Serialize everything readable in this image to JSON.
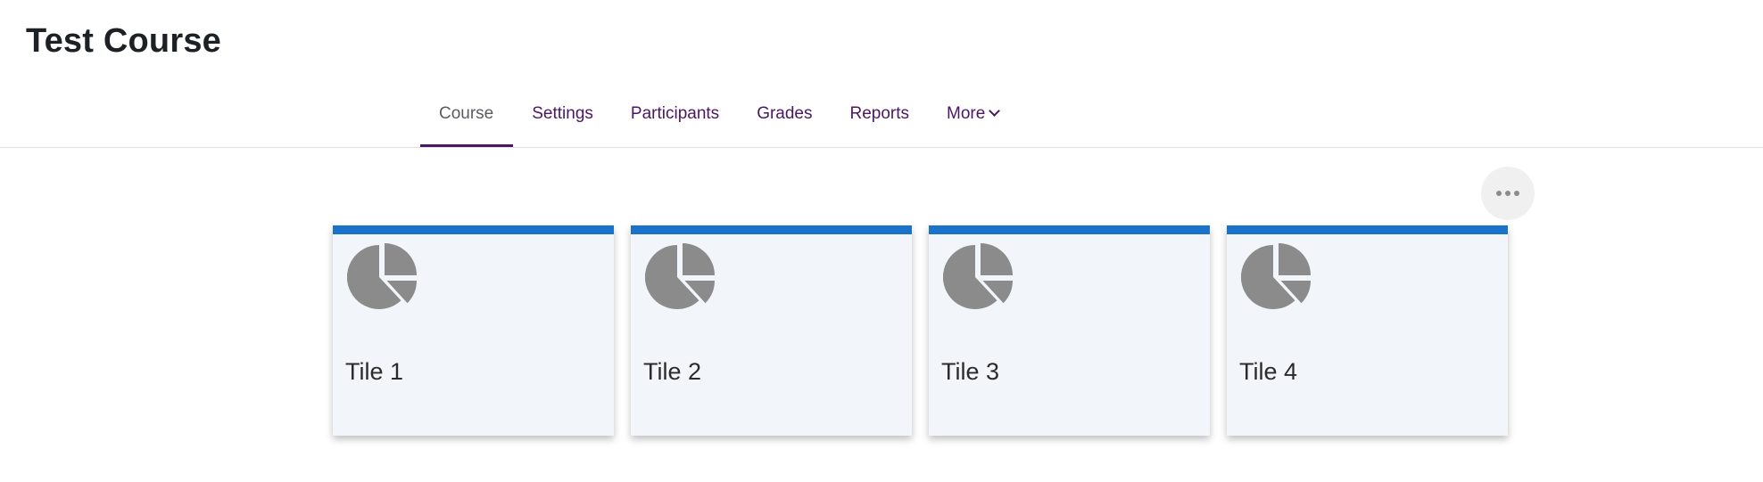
{
  "course": {
    "title": "Test Course"
  },
  "nav": {
    "tabs": [
      {
        "label": "Course",
        "active": true
      },
      {
        "label": "Settings",
        "active": false
      },
      {
        "label": "Participants",
        "active": false
      },
      {
        "label": "Grades",
        "active": false
      },
      {
        "label": "Reports",
        "active": false
      },
      {
        "label": "More",
        "active": false,
        "has_dropdown": true
      }
    ]
  },
  "actions": {
    "more_icon": "ellipsis-icon"
  },
  "tiles": [
    {
      "label": "Tile 1",
      "icon": "pie-chart-icon"
    },
    {
      "label": "Tile 2",
      "icon": "pie-chart-icon"
    },
    {
      "label": "Tile 3",
      "icon": "pie-chart-icon"
    },
    {
      "label": "Tile 4",
      "icon": "pie-chart-icon"
    }
  ],
  "colors": {
    "tile_accent": "#1b73c9",
    "nav_link": "#4b1762",
    "tile_background": "#f2f6fa",
    "icon_gray": "#8b8b8b"
  }
}
